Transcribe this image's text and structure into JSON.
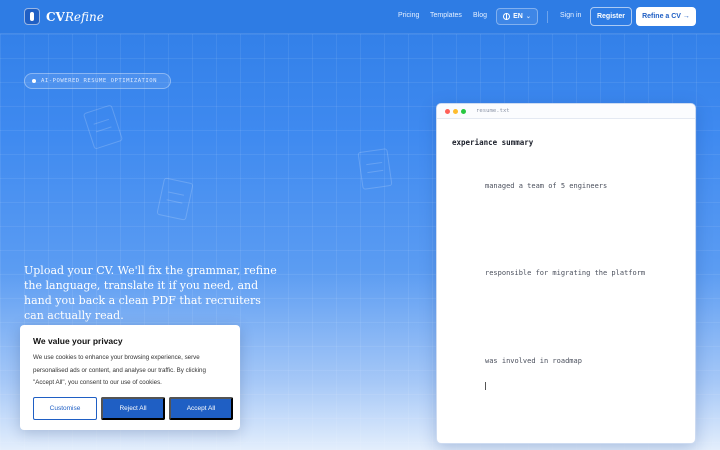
{
  "nav": {
    "logo_main": "CV",
    "logo_accent": "Refine",
    "links": [
      "Pricing",
      "Templates",
      "Blog"
    ],
    "lang": "EN",
    "signin": "Sign in",
    "register": "Register",
    "cta": "Refine a CV →"
  },
  "hero": {
    "badge": "AI-POWERED RESUME OPTIMIZATION",
    "description": "Upload your CV. We'll fix the grammar, refine the language, translate it if you need, and hand you back a clean PDF that recruiters can actually read."
  },
  "editor": {
    "filename": "resume.txt",
    "heading": "experiance summary",
    "lines": [
      "managed a team of 5 engineers",
      "responsible for migrating the platform",
      "was involved in roadmap"
    ],
    "dot_colors": [
      "#ff5f57",
      "#febc2e",
      "#28c840"
    ]
  },
  "cookie": {
    "title": "We value your privacy",
    "text": "We use cookies to enhance your browsing experience, serve personalised ads or content, and analyse our traffic. By clicking \"Accept All\", you consent to our use of cookies.",
    "customise": "Customise",
    "reject": "Reject All",
    "accept": "Accept All"
  },
  "colors": {
    "brand": "#2e7ce4",
    "accent": "#1f5fc4"
  }
}
